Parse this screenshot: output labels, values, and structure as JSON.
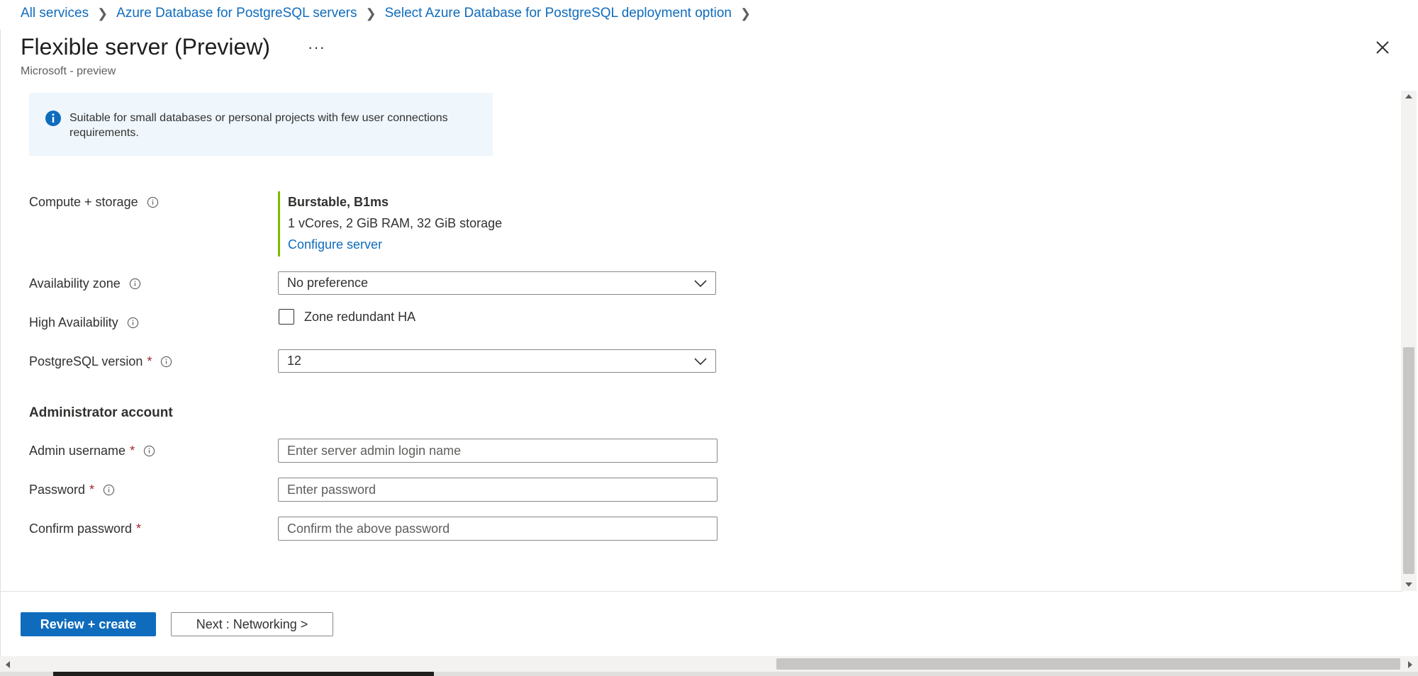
{
  "breadcrumb": {
    "items": [
      "All services",
      "Azure Database for PostgreSQL servers",
      "Select Azure Database for PostgreSQL deployment option"
    ]
  },
  "header": {
    "title": "Flexible server (Preview)",
    "more": "···",
    "subtitle": "Microsoft - preview"
  },
  "info": {
    "text": "Suitable for small databases or personal projects with few user connections requirements."
  },
  "form": {
    "compute": {
      "label": "Compute + storage",
      "tier": "Burstable, B1ms",
      "details": "1 vCores, 2 GiB RAM, 32 GiB storage",
      "link": "Configure server"
    },
    "availability_zone": {
      "label": "Availability zone",
      "value": "No preference"
    },
    "high_availability": {
      "label": "High Availability",
      "checkbox_label": "Zone redundant HA",
      "checked": false
    },
    "postgres_version": {
      "label": "PostgreSQL version",
      "required": "*",
      "value": "12"
    },
    "admin_section": "Administrator account",
    "admin_username": {
      "label": "Admin username",
      "required": "*",
      "placeholder": "Enter server admin login name",
      "value": ""
    },
    "password": {
      "label": "Password",
      "required": "*",
      "placeholder": "Enter password",
      "value": ""
    },
    "confirm_password": {
      "label": "Confirm password",
      "required": "*",
      "placeholder": "Confirm the above password",
      "value": ""
    }
  },
  "footer": {
    "primary": "Review + create",
    "secondary": "Next : Networking >"
  },
  "colors": {
    "accent": "#0f6cbd",
    "info_bg": "#eff6fc",
    "compute_border": "#7fba00",
    "required": "#a4262c"
  },
  "icons": {
    "info": "info-circle-icon",
    "help": "info-outline-icon",
    "chevron": "chevron-down-icon",
    "close": "close-icon",
    "breadcrumb_sep": "chevron-right-icon"
  }
}
